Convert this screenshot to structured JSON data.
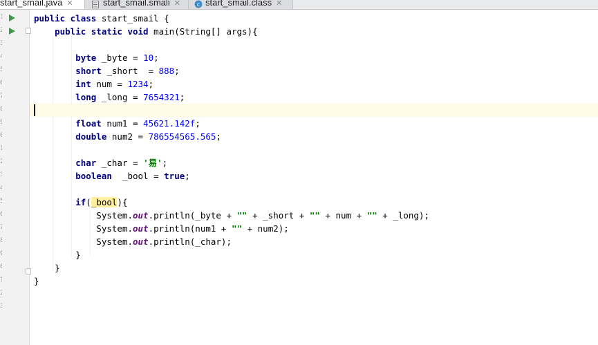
{
  "tabs": [
    {
      "label": "start_smail.java",
      "close": "✕",
      "active": true
    },
    {
      "label": "start_smail.smali",
      "close": "✕",
      "active": false
    },
    {
      "label": "start_smail.class",
      "close": "✕",
      "active": false
    }
  ],
  "editor": {
    "lines": [
      [
        {
          "t": "public class ",
          "c": "kw"
        },
        {
          "t": "start_smail {",
          "c": ""
        }
      ],
      [
        {
          "t": "    public static void ",
          "c": "kw"
        },
        {
          "t": "main(String[] args){",
          "c": ""
        }
      ],
      [],
      [
        {
          "t": "        byte ",
          "c": "kw"
        },
        {
          "t": "_byte = ",
          "c": ""
        },
        {
          "t": "10",
          "c": "num"
        },
        {
          "t": ";",
          "c": ""
        }
      ],
      [
        {
          "t": "        short ",
          "c": "kw"
        },
        {
          "t": "_short  = ",
          "c": ""
        },
        {
          "t": "888",
          "c": "num"
        },
        {
          "t": ";",
          "c": ""
        }
      ],
      [
        {
          "t": "        int ",
          "c": "kw"
        },
        {
          "t": "num = ",
          "c": ""
        },
        {
          "t": "1234",
          "c": "num"
        },
        {
          "t": ";",
          "c": ""
        }
      ],
      [
        {
          "t": "        long ",
          "c": "kw"
        },
        {
          "t": "_long = ",
          "c": ""
        },
        {
          "t": "7654321",
          "c": "num"
        },
        {
          "t": ";",
          "c": ""
        }
      ],
      [],
      [
        {
          "t": "        float ",
          "c": "kw"
        },
        {
          "t": "num1 = ",
          "c": ""
        },
        {
          "t": "45621.142f",
          "c": "num"
        },
        {
          "t": ";",
          "c": ""
        }
      ],
      [
        {
          "t": "        double ",
          "c": "kw"
        },
        {
          "t": "num2 = ",
          "c": ""
        },
        {
          "t": "786554565.565",
          "c": "num"
        },
        {
          "t": ";",
          "c": ""
        }
      ],
      [],
      [
        {
          "t": "        char ",
          "c": "kw"
        },
        {
          "t": "_char = ",
          "c": ""
        },
        {
          "t": "'易'",
          "c": "str"
        },
        {
          "t": ";",
          "c": ""
        }
      ],
      [
        {
          "t": "        boolean  ",
          "c": "kw"
        },
        {
          "t": "_bool = ",
          "c": ""
        },
        {
          "t": "true",
          "c": "kw"
        },
        {
          "t": ";",
          "c": ""
        }
      ],
      [],
      [
        {
          "t": "        if",
          "c": "kw"
        },
        {
          "t": "(",
          "c": ""
        },
        {
          "t": "_bool",
          "c": "hl"
        },
        {
          "t": "){",
          "c": ""
        }
      ],
      [
        {
          "t": "            System.",
          "c": ""
        },
        {
          "t": "out",
          "c": "fld"
        },
        {
          "t": ".println(_byte + ",
          "c": ""
        },
        {
          "t": "\"\"",
          "c": "str"
        },
        {
          "t": " + _short + ",
          "c": ""
        },
        {
          "t": "\"\"",
          "c": "str"
        },
        {
          "t": " + num + ",
          "c": ""
        },
        {
          "t": "\"\"",
          "c": "str"
        },
        {
          "t": " + _long);",
          "c": ""
        }
      ],
      [
        {
          "t": "            System.",
          "c": ""
        },
        {
          "t": "out",
          "c": "fld"
        },
        {
          "t": ".println(num1 + ",
          "c": ""
        },
        {
          "t": "\"\"",
          "c": "str"
        },
        {
          "t": " + num2);",
          "c": ""
        }
      ],
      [
        {
          "t": "            System.",
          "c": ""
        },
        {
          "t": "out",
          "c": "fld"
        },
        {
          "t": ".println(_char);",
          "c": ""
        }
      ],
      [
        {
          "t": "        }",
          "c": ""
        }
      ],
      [
        {
          "t": "    }",
          "c": ""
        }
      ],
      [
        {
          "t": "}",
          "c": ""
        }
      ]
    ],
    "current_line": 7,
    "line_number_fragments": [
      "1",
      "2",
      "3",
      "4",
      "5",
      "6",
      "7",
      "8",
      "9",
      "0",
      "1",
      "2",
      "3",
      "4",
      "5",
      "6",
      "7",
      "8",
      "9",
      "0",
      "1",
      "2",
      "3"
    ]
  },
  "icons": {
    "run_line_1": "run-triangle-icon",
    "run_line_2": "run-triangle-icon",
    "java_file": "java-file-icon",
    "smali_file": "text-file-icon",
    "class_file": "class-file-icon"
  }
}
